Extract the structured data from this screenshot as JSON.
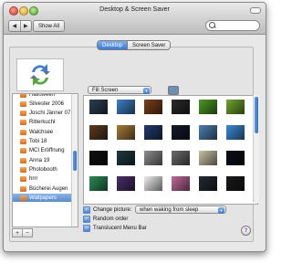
{
  "window": {
    "title": "Desktop & Screen Saver",
    "show_all_label": "Show All",
    "back_glyph": "◀",
    "forward_glyph": "▶",
    "search_placeholder": ""
  },
  "tabs": [
    {
      "label": "Desktop",
      "active": true
    },
    {
      "label": "Screen Saver",
      "active": false
    }
  ],
  "fill_mode": {
    "selected": "Fill Screen"
  },
  "background_color": "#6a8fb9",
  "folders": [
    {
      "label": "Halloween",
      "selected": false
    },
    {
      "label": "Silvester 2006",
      "selected": false
    },
    {
      "label": "Joschi Jänner 07",
      "selected": false
    },
    {
      "label": "Ritterkuchl",
      "selected": false
    },
    {
      "label": "Walchsee",
      "selected": false
    },
    {
      "label": "Tobi 18",
      "selected": false
    },
    {
      "label": "MCI Eröffnung",
      "selected": false
    },
    {
      "label": "Anna 19",
      "selected": false
    },
    {
      "label": "Photobooth",
      "selected": false
    },
    {
      "label": "hrrr",
      "selected": false
    },
    {
      "label": "Bücherei Augen",
      "selected": false
    },
    {
      "label": "Wallpapers",
      "selected": true
    }
  ],
  "list_buttons": {
    "add": "+",
    "remove": "−"
  },
  "wallpapers": [
    {
      "icon": "dark-wave-wallpaper",
      "color": "#2a3f54"
    },
    {
      "icon": "blue-drops-wallpaper",
      "color": "#3f7fc4"
    },
    {
      "icon": "autumn-leaves-wallpaper",
      "color": "#7d3f1a"
    },
    {
      "icon": "dark-portrait-wallpaper",
      "color": "#2b2b2b"
    },
    {
      "icon": "green-grass-wallpaper",
      "color": "#4d9a24"
    },
    {
      "icon": "green-field-wallpaper",
      "color": "#6fa52f"
    },
    {
      "icon": "brown-texture-wallpaper",
      "color": "#5c3b22"
    },
    {
      "icon": "desert-wallpaper",
      "color": "#a67a3a"
    },
    {
      "icon": "aurora-wallpaper",
      "color": "#213b6b"
    },
    {
      "icon": "moon-wallpaper",
      "color": "#151b2b"
    },
    {
      "icon": "ocean-sunset-wallpaper",
      "color": "#4d7fb0"
    },
    {
      "icon": "blue-abstract-wallpaper",
      "color": "#3c8bd6"
    },
    {
      "icon": "black-wallpaper",
      "color": "#111111"
    },
    {
      "icon": "dark-teal-wallpaper",
      "color": "#1e3a3f"
    },
    {
      "icon": "silver-wallpaper",
      "color": "#8e8e8e"
    },
    {
      "icon": "grey-stone-wallpaper",
      "color": "#6b6b6b"
    },
    {
      "icon": "great-wave-wallpaper",
      "color": "#c9c2a4"
    },
    {
      "icon": "space-wallpaper",
      "color": "#0c0f1a"
    },
    {
      "icon": "green-light-wallpaper",
      "color": "#2e8b57"
    },
    {
      "icon": "purple-wallpaper",
      "color": "#4a2e6b"
    },
    {
      "icon": "white-wallpaper",
      "color": "#efefef"
    },
    {
      "icon": "rainbow-wallpaper",
      "color": "#c06a9a"
    },
    {
      "icon": "dark-grid-wallpaper",
      "color": "#222a33"
    },
    {
      "icon": "apple-logo-wallpaper",
      "color": "#1a1a1a"
    }
  ],
  "options": {
    "change_picture": {
      "label": "Change picture:",
      "checked": true
    },
    "change_interval": "when waking from sleep",
    "random_order": {
      "label": "Random order",
      "checked": true
    },
    "translucent_menu_bar": {
      "label": "Translucent Menu Bar",
      "checked": true
    }
  },
  "help_glyph": "?"
}
